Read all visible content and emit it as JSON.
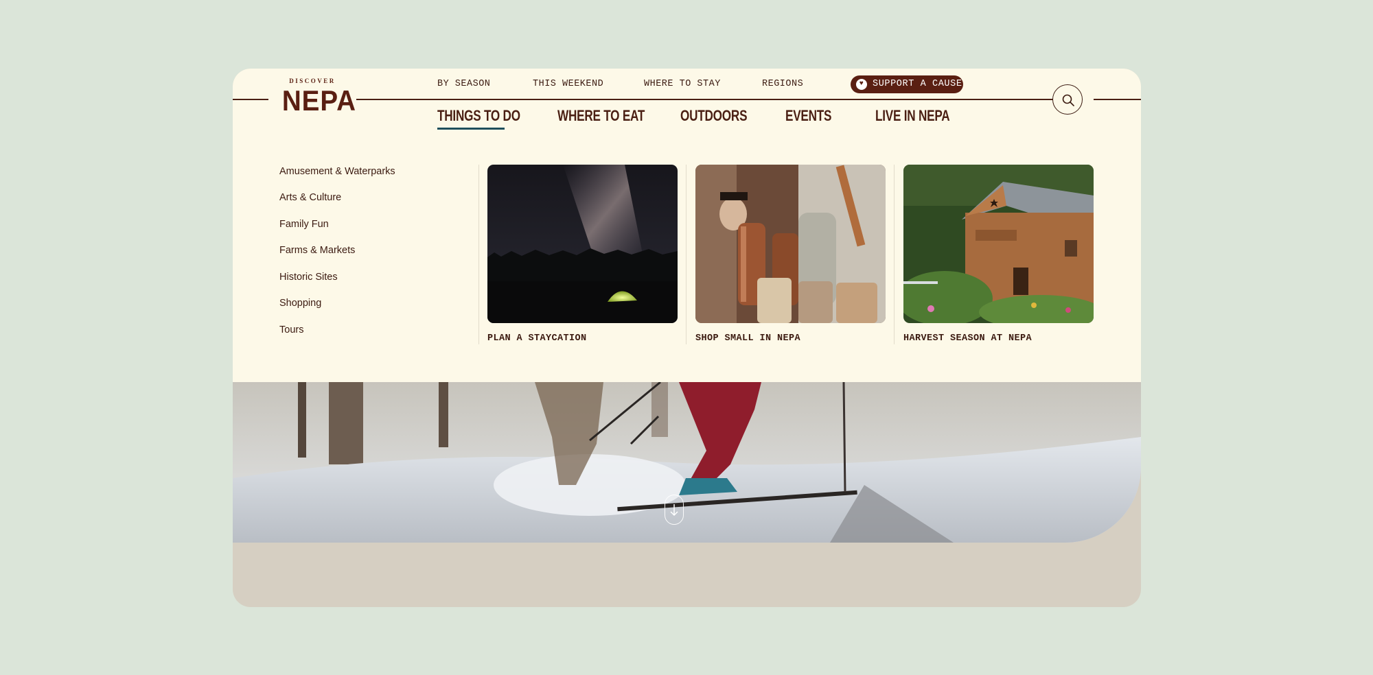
{
  "brand": {
    "logo_small": "DISCOVER",
    "logo_big": "NEPA"
  },
  "utility_nav": [
    "BY SEASON",
    "THIS WEEKEND",
    "WHERE TO STAY",
    "REGIONS"
  ],
  "support_button": {
    "label": "SUPPORT A CAUSE",
    "icon": "heart-icon"
  },
  "search_button": {
    "icon": "search-icon"
  },
  "main_nav": [
    "THINGS TO DO",
    "WHERE TO EAT",
    "OUTDOORS",
    "EVENTS",
    "LIVE IN NEPA"
  ],
  "active_main_nav": "THINGS TO DO",
  "submenu_items": [
    "Amusement & Waterparks",
    "Arts & Culture",
    "Family Fun",
    "Farms & Markets",
    "Historic Sites",
    "Shopping",
    "Tours"
  ],
  "featured_cards": [
    {
      "title": "PLAN A STAYCATION",
      "image": "night-sky-tent-photo"
    },
    {
      "title": "SHOP SMALL IN NEPA",
      "image": "copper-shop-display-photo"
    },
    {
      "title": "HARVEST SEASON AT NEPA",
      "image": "mercantile-barn-photo"
    }
  ],
  "hero": {
    "image": "skier-snow-photo",
    "scroll_icon": "scroll-down-arrow-icon"
  },
  "colors": {
    "page_background": "#dbe5d9",
    "header_background": "#fdf9e8",
    "brand_brown": "#5a1f12",
    "active_underline": "#1f4f5c",
    "footer_band": "#d6cfc2"
  }
}
